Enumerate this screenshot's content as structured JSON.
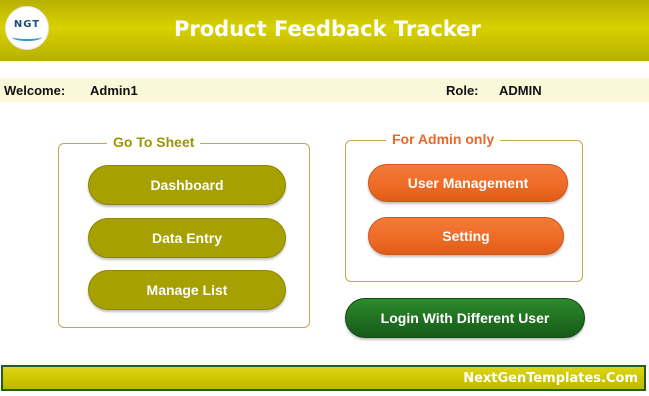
{
  "header": {
    "title": "Product Feedback Tracker",
    "logo_text": "NGT",
    "logo_icon": "ngt-logo-icon"
  },
  "welcome_bar": {
    "welcome_label": "Welcome:",
    "user_name": "Admin1",
    "role_label": "Role:",
    "role_value": "ADMIN"
  },
  "go_to_sheet": {
    "title": "Go To Sheet",
    "buttons": [
      {
        "label": "Dashboard"
      },
      {
        "label": "Data Entry"
      },
      {
        "label": "Manage List"
      }
    ]
  },
  "admin_section": {
    "title": "For Admin only",
    "buttons": [
      {
        "label": "User Management"
      },
      {
        "label": "Setting"
      }
    ]
  },
  "login_button": {
    "label": "Login With Different User"
  },
  "footer": {
    "text": "NextGenTemplates.Com"
  },
  "colors": {
    "header_bar": "#c9c200",
    "title_text": "#ffffff",
    "welcome_bar_bg": "#fbf7d9",
    "group_border": "#c7a553",
    "go_to_sheet_title": "#9c9500",
    "admin_title": "#e8692a",
    "olive_button": "#a6a000",
    "orange_button": "#ed6a24",
    "green_button": "#1f6d20",
    "footer_bar": "#cec800"
  }
}
